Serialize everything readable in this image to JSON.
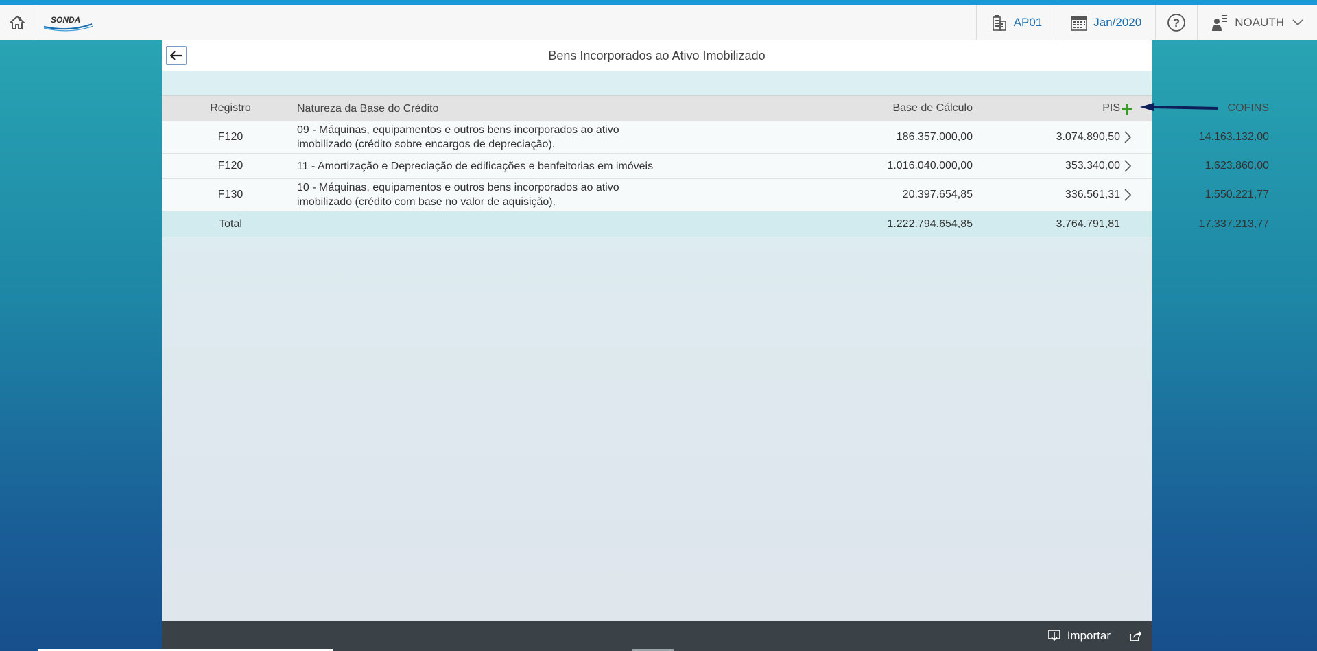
{
  "brand": {
    "logo_text": "SONDA"
  },
  "topbar": {
    "company_label": "AP01",
    "period_label": "Jan/2020",
    "user_label": "NOAUTH"
  },
  "page": {
    "title": "Bens Incorporados ao Ativo Imobilizado"
  },
  "table": {
    "headers": {
      "registro": "Registro",
      "natureza": "Natureza da Base do Crédito",
      "base": "Base de Cálculo",
      "pis": "PIS",
      "cofins": "COFINS"
    },
    "rows": [
      {
        "registro": "F120",
        "natureza_line1": "09 - Máquinas, equipamentos e outros bens incorporados ao ativo",
        "natureza_line2": "imobilizado (crédito sobre encargos de depreciação).",
        "base": "186.357.000,00",
        "pis": "3.074.890,50",
        "cofins": "14.163.132,00"
      },
      {
        "registro": "F120",
        "natureza_line1": "11 - Amortização e Depreciação de edificações e benfeitorias em imóveis",
        "natureza_line2": "",
        "base": "1.016.040.000,00",
        "pis": "353.340,00",
        "cofins": "1.623.860,00"
      },
      {
        "registro": "F130",
        "natureza_line1": "10 - Máquinas, equipamentos e outros bens incorporados ao ativo",
        "natureza_line2": "imobilizado (crédito com base no valor de aquisição).",
        "base": "20.397.654,85",
        "pis": "336.561,31",
        "cofins": "1.550.221,77"
      }
    ],
    "total": {
      "label": "Total",
      "base": "1.222.794.654,85",
      "pis": "3.764.791,81",
      "cofins": "17.337.213,77"
    }
  },
  "footer": {
    "import_label": "Importar"
  },
  "colors": {
    "accent_blue": "#1a6fb3",
    "add_green": "#3a9a2a",
    "footer_bg": "#3b4247",
    "annotation_arrow": "#0f1f5c"
  }
}
